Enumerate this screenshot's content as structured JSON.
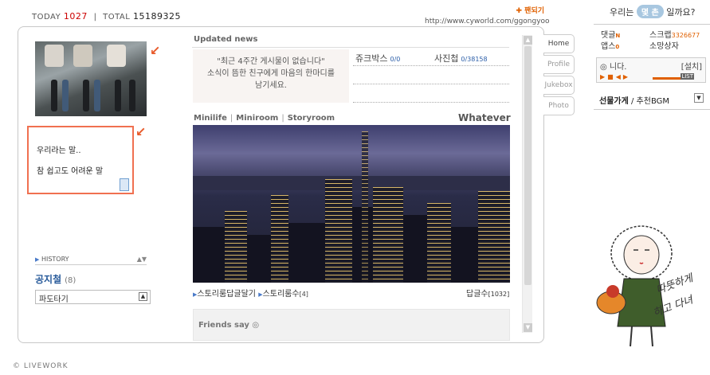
{
  "stats": {
    "today_label": "TODAY",
    "today_value": "1027",
    "sep": "|",
    "total_label": "TOTAL",
    "total_value": "15189325"
  },
  "header": {
    "pado_label": "✚ 팬되기",
    "url": "http://www.cyworld.com/ggongyoo"
  },
  "profile": {
    "note_lines": [
      "우리라는 말..",
      "참 쉽고도 어려운 말"
    ],
    "history_label": "HISTORY",
    "owner_name": "공지철",
    "owner_count": "(8)",
    "select_value": "파도타기"
  },
  "updated": {
    "title": "Updated news",
    "empty_line1": "\"최근 4주간 게시물이 없습니다\"",
    "empty_line2": "소식이 뜸한 친구에게 마음의 한마디를",
    "empty_line3": "남기세요.",
    "jukebox_label": "쥬크박스",
    "jukebox_value": "0/0",
    "photo_label": "사진첩",
    "photo_value": "0/38158"
  },
  "room": {
    "tabs": [
      "Minilife",
      "Miniroom",
      "Storyroom"
    ],
    "title": "Whatever",
    "caption1": "스토리룸답글달기",
    "caption2": "스토리룸수",
    "caption2_count": "[4]",
    "reply_label": "답글수",
    "reply_count": "[1032]"
  },
  "friends": {
    "title": "Friends say ◎"
  },
  "side_tabs": [
    "Home",
    "Profile",
    "Jukebox",
    "Photo"
  ],
  "right": {
    "top_prefix": "우리는",
    "top_pill": "몇 촌",
    "top_suffix": "일까요?",
    "grid": [
      {
        "a": "댓글",
        "a_new": "N",
        "b": "스크랩",
        "b_val": "3326677"
      },
      {
        "a": "앱스",
        "a_new": "0",
        "b": "소망상자",
        "b_val": ""
      }
    ],
    "player_title": "◎ 니다.",
    "player_set": "[설치]",
    "player_list": "LIST",
    "gift_bold": "선물가게",
    "gift_rest": "/ 추천BGM"
  },
  "footer": {
    "brand": "© LIVEWORK"
  },
  "handwriting": {
    "line1": "따뜻하게",
    "line2": "하고 다녀"
  }
}
